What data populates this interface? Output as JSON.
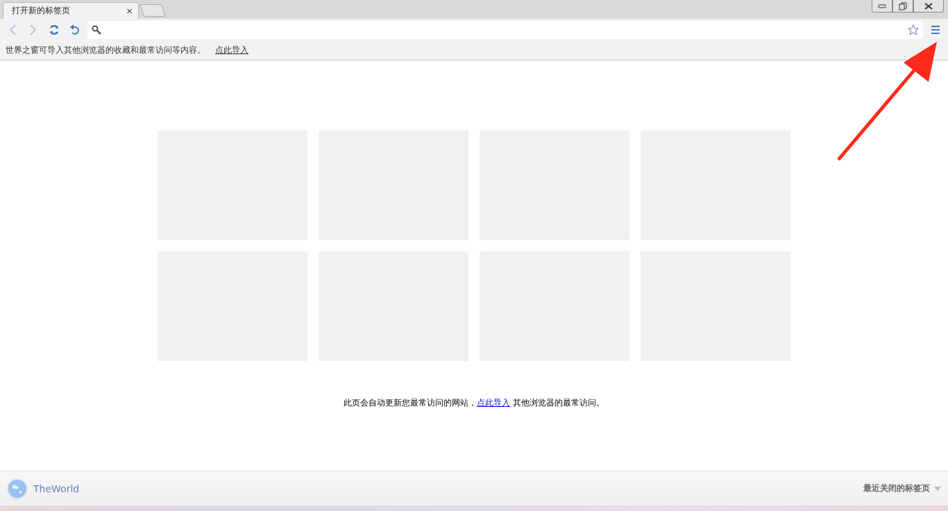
{
  "tabs": [
    {
      "label": "打开新的标签页",
      "close": "×",
      "selected": true
    }
  ],
  "info_bar": {
    "message": "世界之窗可导入其他浏览器的收藏和最常访问等内容。",
    "link": "点此导入"
  },
  "notice": {
    "before": "此页会自动更新您最常访问的网站，",
    "link": "点此导入",
    "after": "其他浏览器的最常访问。"
  },
  "footer": {
    "brand": "TheWorld",
    "recently_closed": "最近关闭的标签页"
  }
}
